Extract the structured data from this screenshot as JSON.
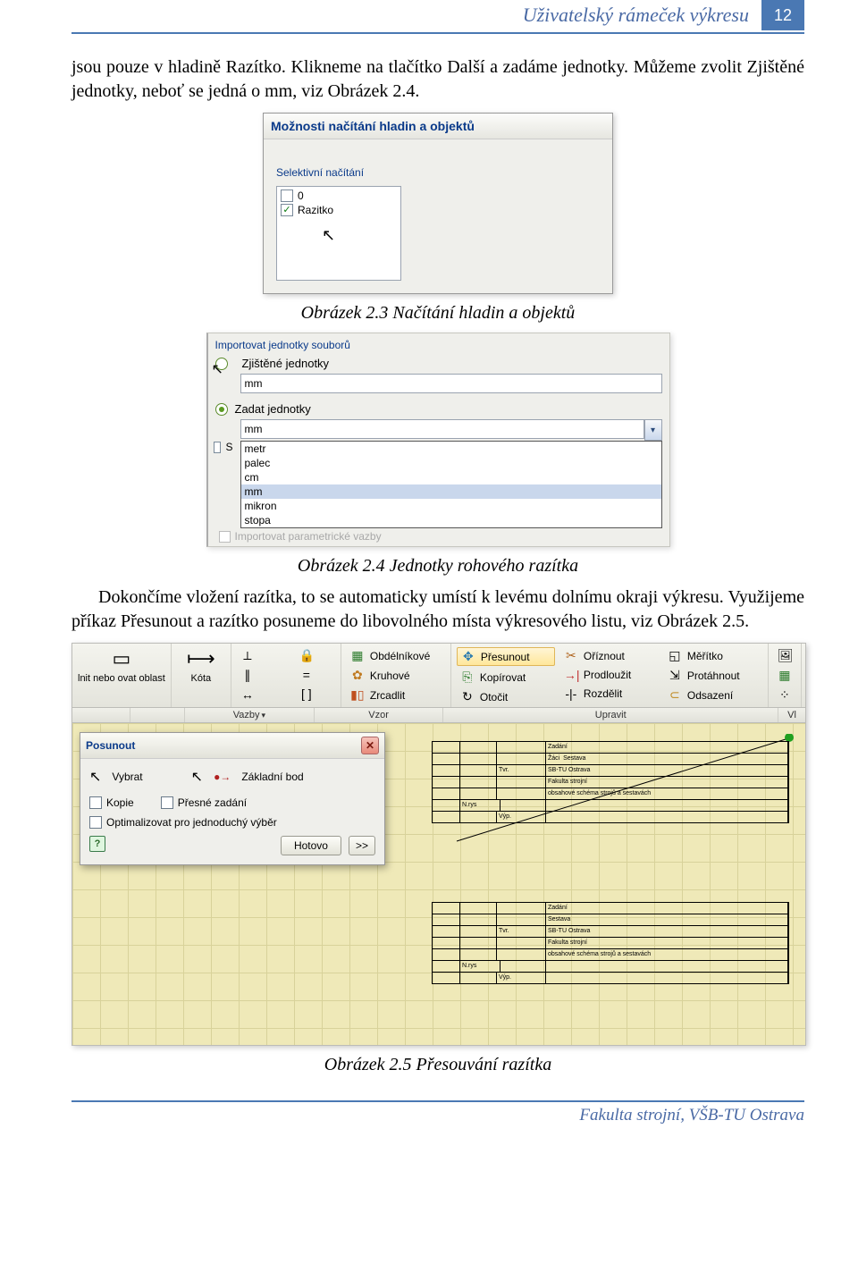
{
  "header": {
    "title": "Uživatelský rámeček výkresu",
    "page": "12"
  },
  "para1": "jsou pouze v hladině Razítko. Klikneme na tlačítko Další a zadáme jednotky. Můžeme zvolit Zjištěné jednotky, neboť se jedná o mm, viz Obrázek 2.4.",
  "caption1": "Obrázek 2.3 Načítání hladin a objektů",
  "shot1": {
    "dialog_title": "Možnosti načítání hladin a objektů",
    "group_label": "Selektivní načítání",
    "item0": "0",
    "item1": "Razitko"
  },
  "shot2": {
    "group_label": "Importovat jednotky souborů",
    "radio1": "Zjištěné jednotky",
    "val1": "mm",
    "radio2": "Zadat jednotky",
    "combo_val": "mm",
    "options": [
      "metr",
      "palec",
      "cm",
      "mm",
      "mikron",
      "stopa"
    ],
    "footer_cb": "Importovat parametrické vazby",
    "side_label": "S"
  },
  "caption2": "Obrázek 2.4 Jednotky rohového razítka",
  "para2": "Dokončíme vložení razítka, to se automaticky umístí k levému dolnímu okraji výkresu. Využijeme příkaz Přesunout a razítko posuneme do libovolného místa výkresového listu, viz Obrázek 2.5.",
  "shot3": {
    "big1": "lnit nebo ovat oblast",
    "big2": "Kóta",
    "groups": {
      "vzor": {
        "obdelnikove": "Obdélníkové",
        "kruhove": "Kruhové",
        "zrcadlit": "Zrcadlit"
      },
      "upravit1": {
        "presunout": "Přesunout",
        "kopirovat": "Kopírovat",
        "otocit": "Otočit"
      },
      "upravit2": {
        "oriznout": "Oříznout",
        "prodlouzit": "Prodloužit",
        "rozdelit": "Rozdělit"
      },
      "upravit3": {
        "meritko": "Měřítko",
        "protahnout": "Protáhnout",
        "odsazeni": "Odsazení"
      }
    },
    "footers": {
      "vazby": "Vazby",
      "vzor": "Vzor",
      "upravit": "Upravit",
      "vl": "Vl"
    },
    "panel": {
      "title": "Posunout",
      "vybrat": "Vybrat",
      "zakladni": "Základní bod",
      "kopie": "Kopie",
      "presne": "Přesné zadání",
      "optim": "Optimalizovat pro jednoduchý výběr",
      "hotovo": "Hotovo",
      "more": ">>"
    }
  },
  "caption3": "Obrázek 2.5 Přesouvání razítka",
  "footer": "Fakulta strojní, VŠB-TU Ostrava"
}
